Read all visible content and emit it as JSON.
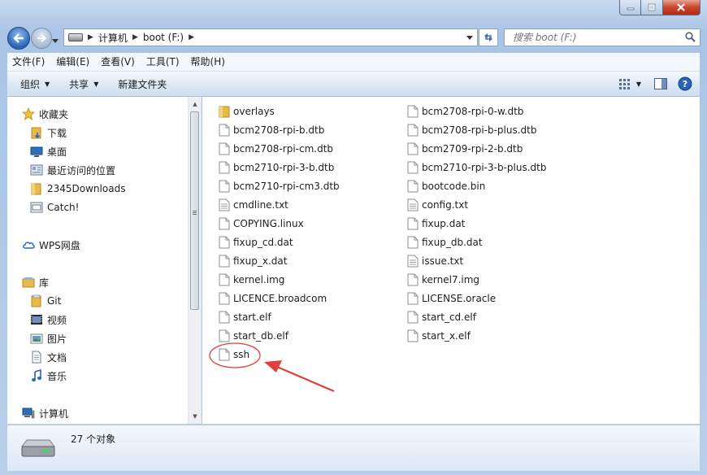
{
  "window": {
    "title": ""
  },
  "address": {
    "crumbs": [
      "计算机",
      "boot (F:)"
    ]
  },
  "search": {
    "placeholder": "搜索 boot (F:)"
  },
  "menu": [
    "文件(F)",
    "编辑(E)",
    "查看(V)",
    "工具(T)",
    "帮助(H)"
  ],
  "toolbar": {
    "organize": "组织",
    "share": "共享",
    "new_folder": "新建文件夹"
  },
  "sidebar": {
    "favorites": {
      "label": "收藏夹",
      "items": [
        "下载",
        "桌面",
        "最近访问的位置",
        "2345Downloads",
        "Catch!"
      ]
    },
    "wps": "WPS网盘",
    "library": {
      "label": "库",
      "items": [
        "Git",
        "视频",
        "图片",
        "文档",
        "音乐"
      ]
    },
    "computer": "计算机"
  },
  "files": {
    "col1": [
      "overlays",
      "bcm2708-rpi-b.dtb",
      "bcm2708-rpi-cm.dtb",
      "bcm2710-rpi-3-b.dtb",
      "bcm2710-rpi-cm3.dtb",
      "cmdline.txt",
      "COPYING.linux",
      "fixup_cd.dat",
      "fixup_x.dat",
      "kernel.img",
      "LICENCE.broadcom",
      "start.elf",
      "start_db.elf",
      "ssh"
    ],
    "col2": [
      "bcm2708-rpi-0-w.dtb",
      "bcm2708-rpi-b-plus.dtb",
      "bcm2709-rpi-2-b.dtb",
      "bcm2710-rpi-3-b-plus.dtb",
      "bootcode.bin",
      "config.txt",
      "fixup.dat",
      "fixup_db.dat",
      "issue.txt",
      "kernel7.img",
      "LICENSE.oracle",
      "start_cd.elf",
      "start_x.elf"
    ]
  },
  "status": {
    "count": "27 个对象"
  },
  "colors": {
    "accent": "#2a64b8",
    "annotation": "#e0403a",
    "folder": "#e8b84a"
  }
}
